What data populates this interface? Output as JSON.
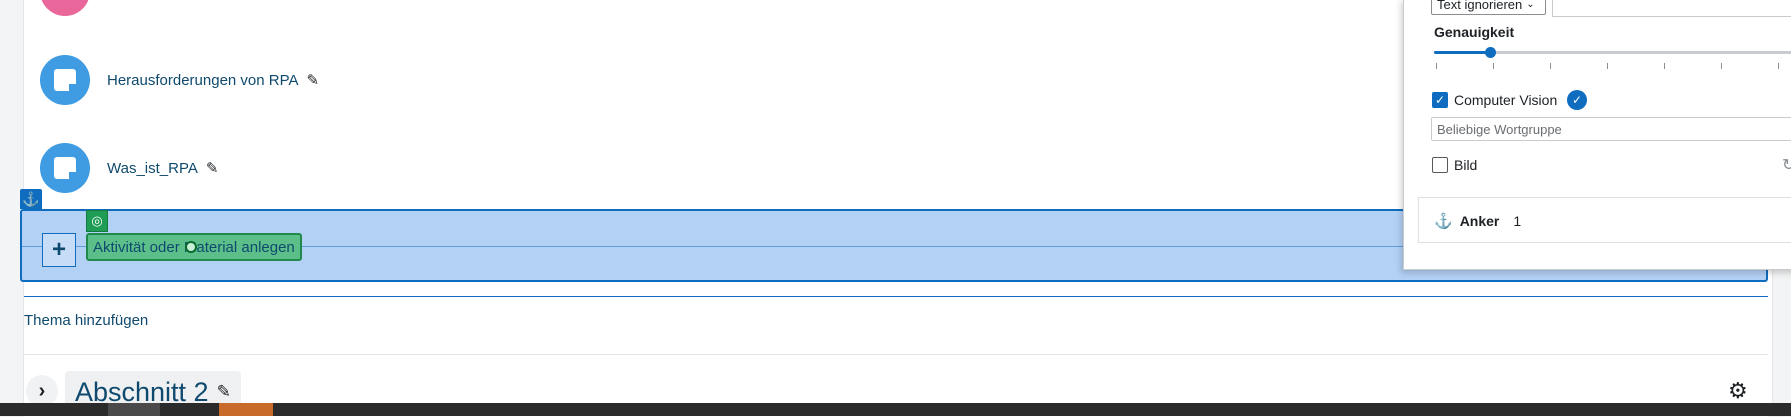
{
  "course": {
    "activities": [
      {
        "label": "Herausforderungen von RPA",
        "icon": "document-icon"
      },
      {
        "label": "Was_ist_RPA",
        "icon": "document-icon"
      }
    ],
    "add_activity_label": "Aktivität oder Material anlegen",
    "add_topic_label": "Thema hinzufügen",
    "section_title": "Abschnitt 2"
  },
  "panel": {
    "text_mode_value": "Text ignorieren",
    "accuracy_label": "Genauigkeit",
    "accuracy_level": 0.15,
    "computer_vision_label": "Computer Vision",
    "computer_vision_checked": true,
    "phrase_placeholder": "Beliebige Wortgruppe",
    "image_label": "Bild",
    "image_checked": false,
    "anchor_label": "Anker",
    "anchor_value": "1"
  },
  "colors": {
    "accent": "#0f6cbf",
    "highlight": "#b3d1f5",
    "target_green": "#5cbf8a",
    "activity_icon": "#3f9be2",
    "pink_icon": "#e9679a"
  }
}
